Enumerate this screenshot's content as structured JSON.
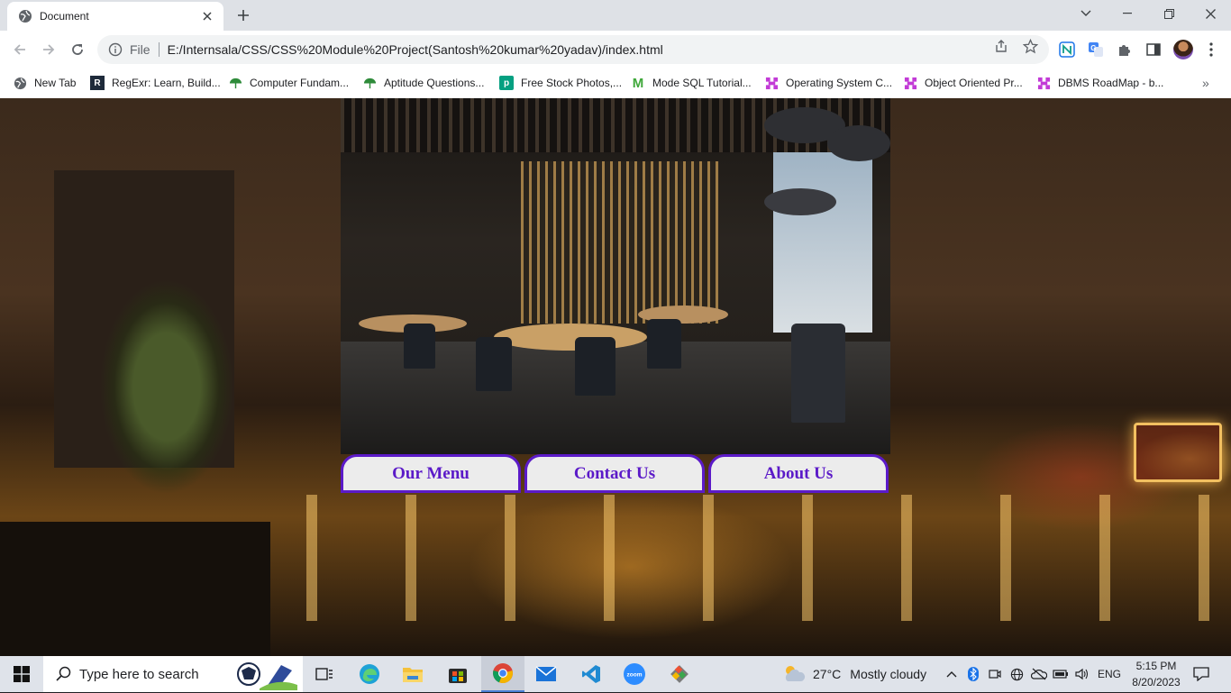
{
  "browser": {
    "tab_title": "Document",
    "address_scheme": "File",
    "address_url": "E:/Internsala/CSS/CSS%20Module%20Project(Santosh%20kumar%20yadav)/index.html",
    "bookmarks": [
      {
        "label": "New Tab",
        "icon": "globe-icon"
      },
      {
        "label": "RegExr: Learn, Build...",
        "icon": "regexr-icon"
      },
      {
        "label": "Computer Fundam...",
        "icon": "umbrella-icon"
      },
      {
        "label": "Aptitude Questions...",
        "icon": "umbrella-icon"
      },
      {
        "label": "Free Stock Photos,...",
        "icon": "pexels-icon"
      },
      {
        "label": "Mode SQL Tutorial...",
        "icon": "mode-icon"
      },
      {
        "label": "Operating System C...",
        "icon": "dots-icon"
      },
      {
        "label": "Object Oriented Pr...",
        "icon": "dots-icon"
      },
      {
        "label": "DBMS RoadMap - b...",
        "icon": "dots-icon"
      }
    ],
    "more_bookmarks": "»"
  },
  "page": {
    "nav": [
      {
        "label": "Our Menu"
      },
      {
        "label": "Contact Us"
      },
      {
        "label": "About Us"
      }
    ],
    "accent_color": "#5b1ac8"
  },
  "taskbar": {
    "search_placeholder": "Type here to search",
    "weather_temp": "27°C",
    "weather_text": "Mostly cloudy",
    "language": "ENG",
    "time": "5:15 PM",
    "date": "8/20/2023",
    "apps": [
      "task-view-icon",
      "edge-icon",
      "file-explorer-icon",
      "store-icon",
      "chrome-icon",
      "mail-icon",
      "vscode-icon",
      "zoom-icon",
      "git-icon"
    ]
  }
}
